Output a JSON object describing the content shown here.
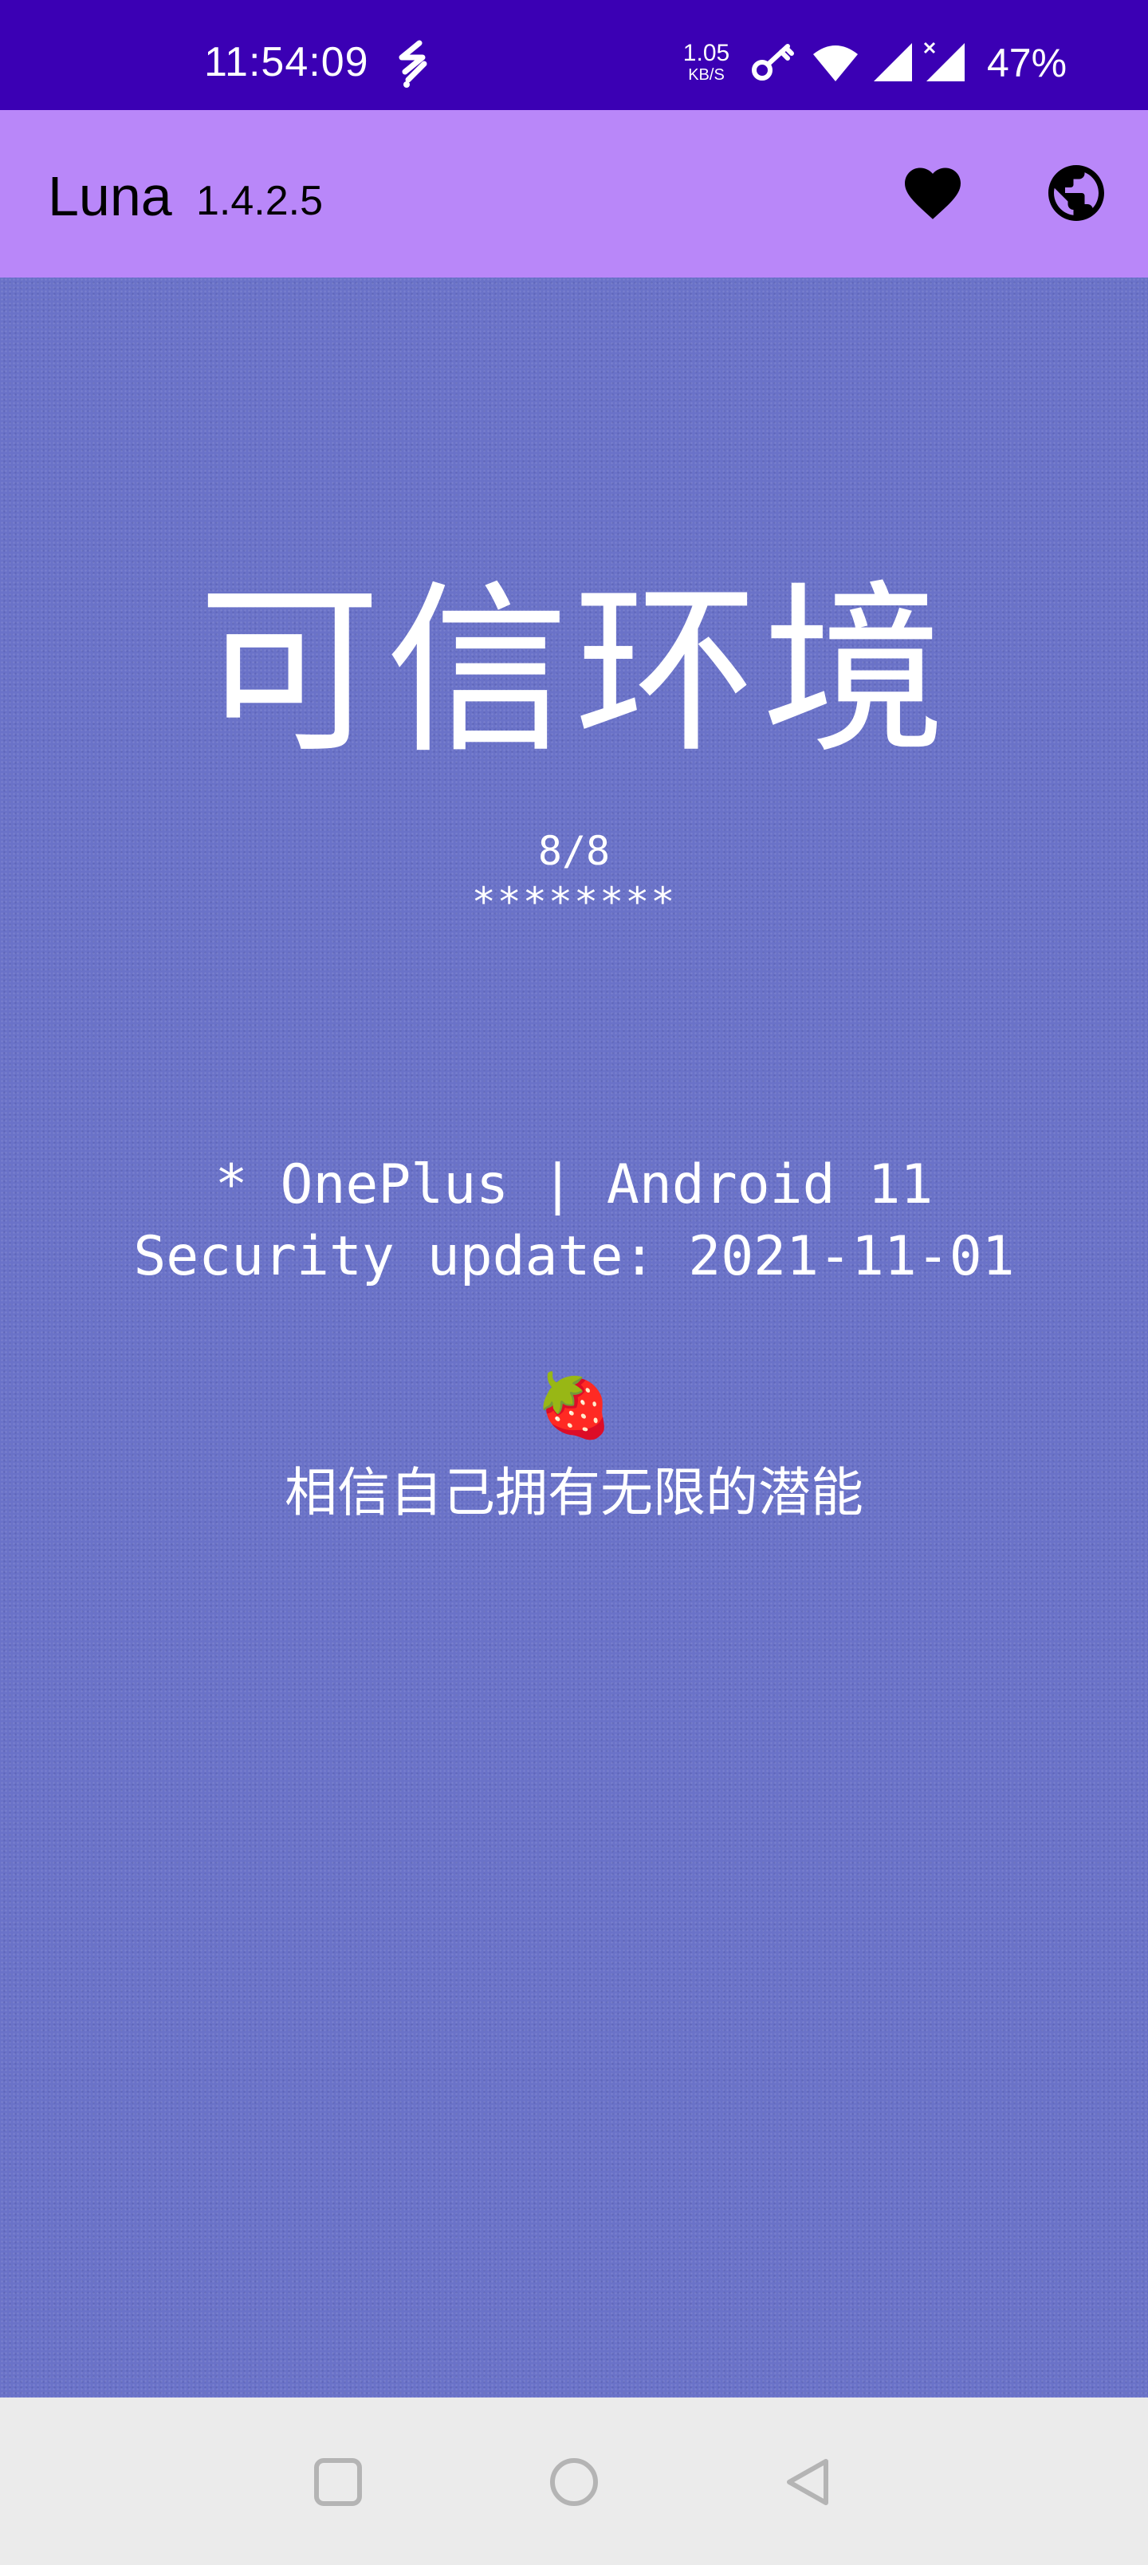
{
  "status_bar": {
    "time": "11:54:09",
    "net_speed_value": "1.05",
    "net_speed_unit": "KB/S",
    "battery": "47%",
    "icons": [
      "activity-icon",
      "key-icon",
      "wifi-icon",
      "signal-icon",
      "signal-x-icon"
    ]
  },
  "app_bar": {
    "title": "Luna",
    "version": "1.4.2.5",
    "actions": [
      "heart-icon",
      "globe-icon"
    ]
  },
  "main": {
    "status_title": "可信环境",
    "score": "8/8",
    "stars": "********",
    "device": "* OnePlus | Android 11",
    "security_update": "Security update: 2021-11-01",
    "emoji": "🍓",
    "motto": "相信自己拥有无限的潜能"
  },
  "nav_bar": {
    "buttons": [
      "recent-apps-icon",
      "home-icon",
      "back-icon"
    ]
  },
  "colors": {
    "status_bar": "#3b00b4",
    "app_bar": "#b987f9",
    "background": "#6a72c8",
    "nav_bar": "#ebebeb"
  }
}
